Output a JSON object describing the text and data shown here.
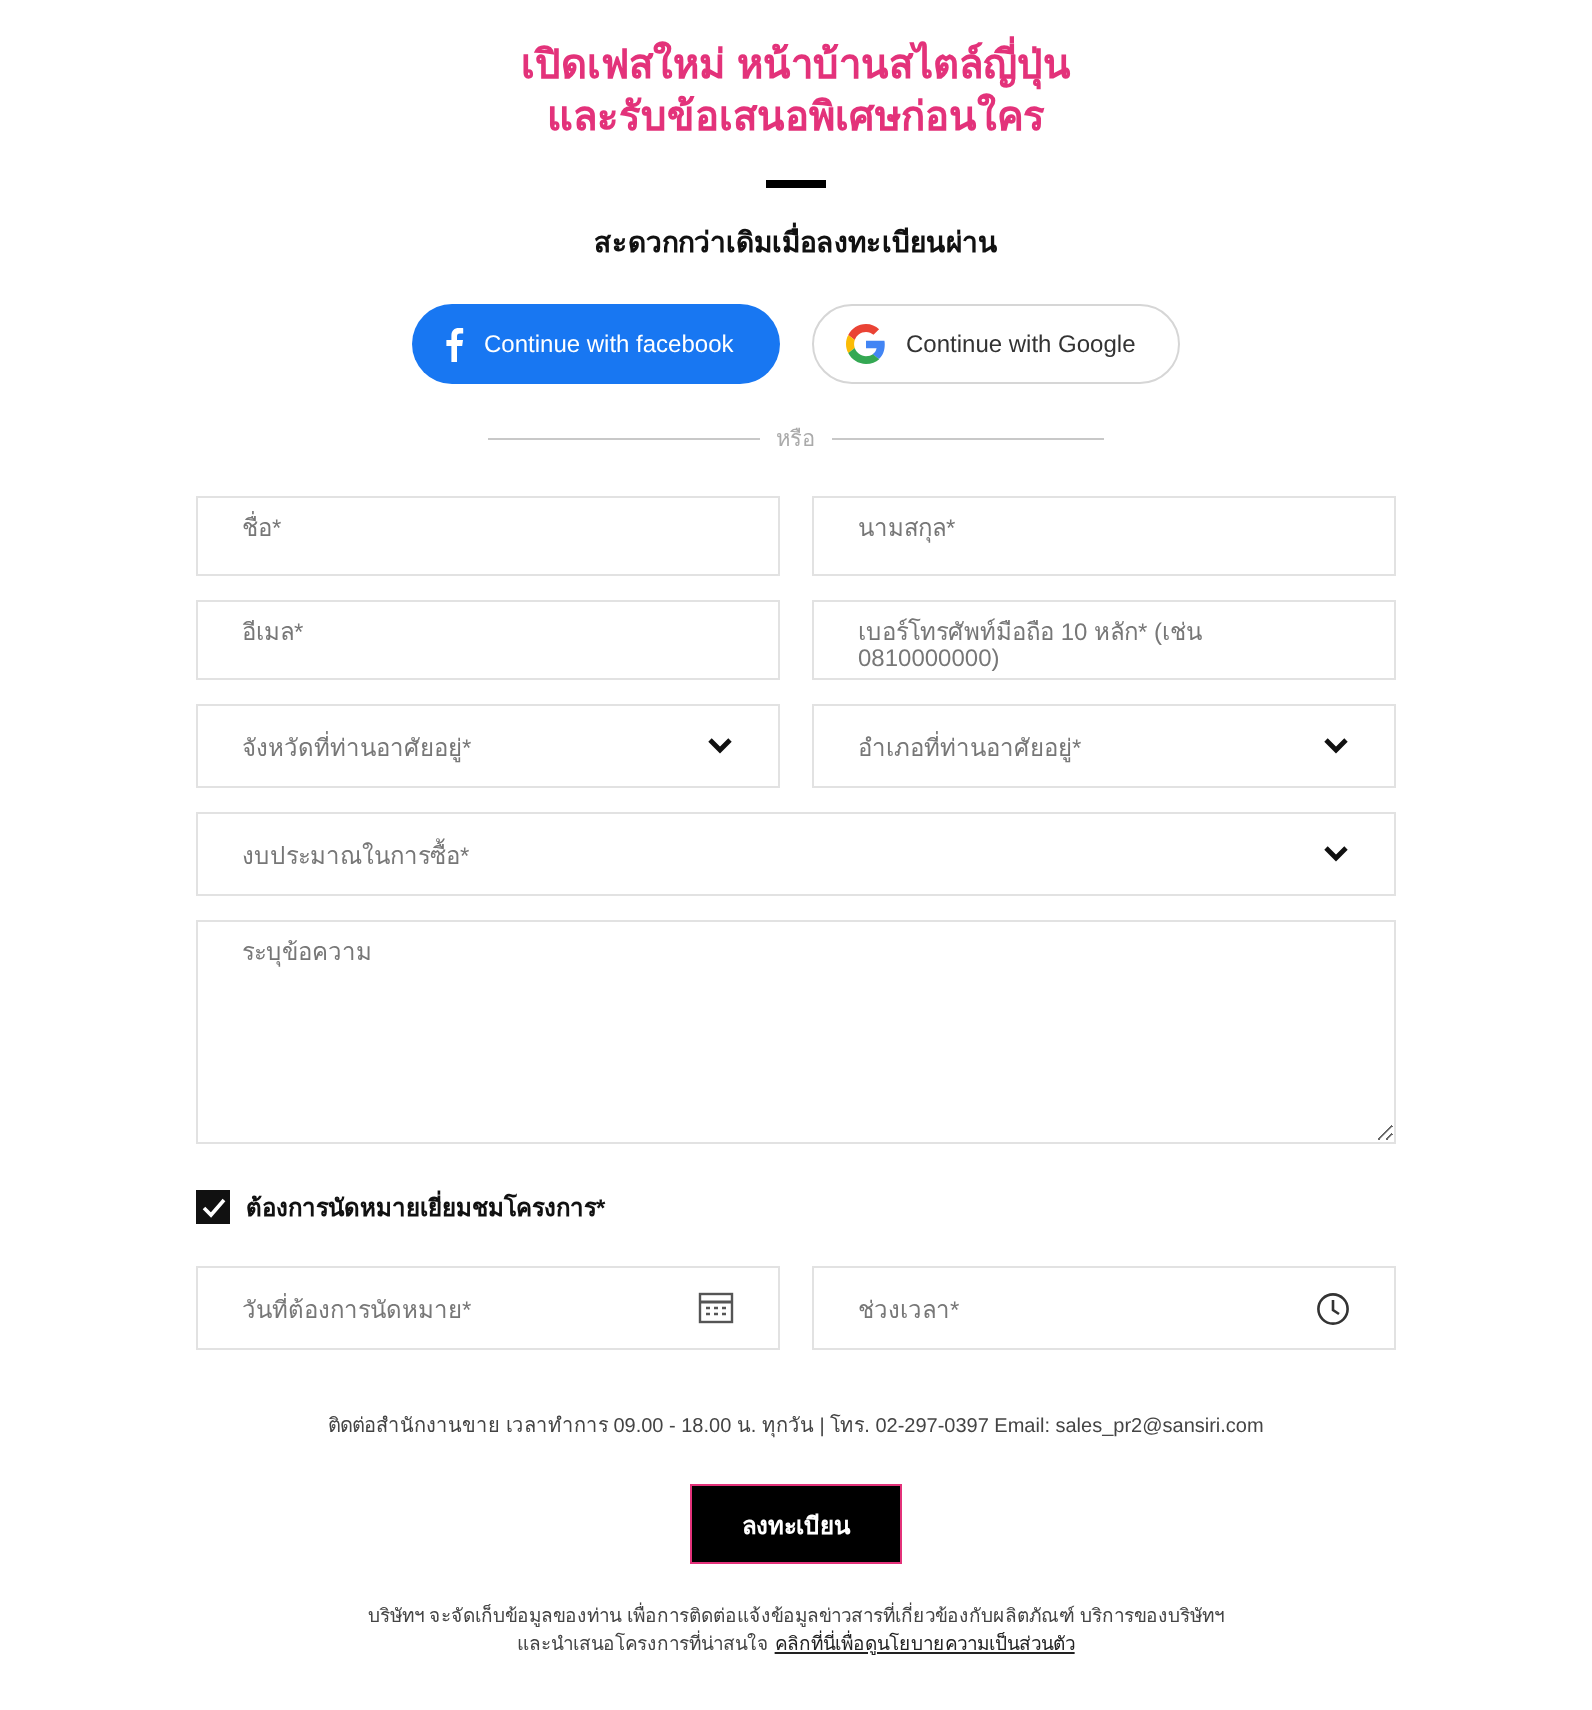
{
  "heading": {
    "lines": [
      "เปิดเฟสใหม่ หน้าบ้านสไตล์ญี่ปุ่น",
      "และรับข้อเสนอพิเศษก่อนใคร"
    ]
  },
  "subtitle": "สะดวกกว่าเดิมเมื่อลงทะเบียนผ่าน",
  "social_buttons": [
    {
      "kind": "facebook",
      "label": "Continue with facebook"
    },
    {
      "kind": "google",
      "label": "Continue with Google"
    }
  ],
  "divider_label": "หรือ",
  "fields": [
    {
      "kind": "text",
      "placeholder": "ชื่อ*",
      "wide": false
    },
    {
      "kind": "text",
      "placeholder": "นามสกุล*",
      "wide": false
    },
    {
      "kind": "text",
      "placeholder": "อีเมล*",
      "wide": false
    },
    {
      "kind": "text",
      "placeholder": "เบอร์โทรศัพท์มือถือ 10 หลัก* (เช่น 0810000000)",
      "wide": false
    },
    {
      "kind": "select",
      "placeholder": "จังหวัดที่ท่านอาศัยอยู่*",
      "wide": false
    },
    {
      "kind": "select",
      "placeholder": "อำเภอที่ท่านอาศัยอยู่*",
      "wide": false
    },
    {
      "kind": "select",
      "placeholder": "งบประมาณในการซื้อ*",
      "wide": true
    },
    {
      "kind": "textarea",
      "placeholder": "ระบุข้อความ",
      "wide": true
    }
  ],
  "appointment": {
    "label": "ต้องการนัดหมายเยี่ยมชมโครงการ*",
    "checked": true
  },
  "appointment_fields": [
    {
      "kind": "date",
      "placeholder": "วันที่ต้องการนัดหมาย*"
    },
    {
      "kind": "time",
      "placeholder": "ช่วงเวลา*"
    }
  ],
  "contact": "ติดต่อสำนักงานขาย เวลาทำการ 09.00 - 18.00 น. ทุกวัน | โทร. 02-297-0397 Email: sales_pr2@sansiri.com",
  "submit": "ลงทะเบียน",
  "notice": {
    "text": "บริษัทฯ จะจัดเก็บข้อมูลของท่าน เพื่อการติดต่อแจ้งข้อมูลข่าวสารที่เกี่ยวข้องกับผลิตภัณฑ์ บริการของบริษัทฯ\nและนำเสนอโครงการที่น่าสนใจ ",
    "link": "คลิกที่นี่เพื่อดูนโยบายความเป็นส่วนตัว"
  }
}
